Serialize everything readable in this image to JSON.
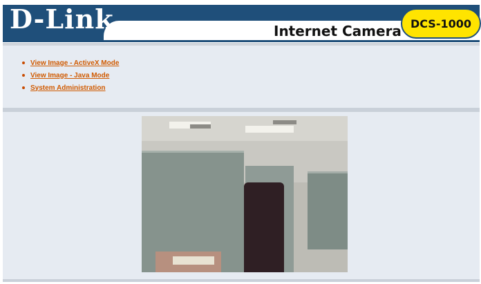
{
  "header": {
    "logo": "D-Link",
    "subtitle": "Internet Camera",
    "model_badge": "DCS-1000"
  },
  "nav": {
    "links": [
      {
        "label": "View Image - ActiveX Mode"
      },
      {
        "label": "View Image - Java Mode"
      },
      {
        "label": "System Administration"
      }
    ]
  },
  "colors": {
    "brand_blue": "#1f4f7a",
    "badge_yellow": "#ffe400",
    "link_orange": "#d05a00",
    "panel_bg": "#e6ebf2"
  },
  "icons": {
    "bullet": "bullet-icon"
  }
}
